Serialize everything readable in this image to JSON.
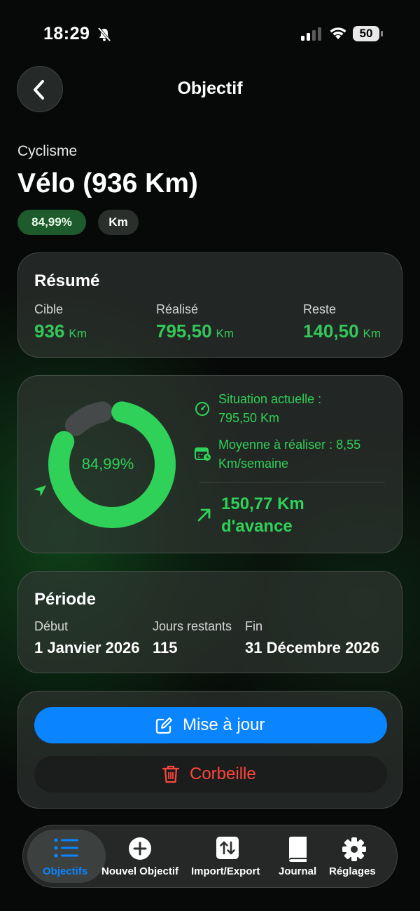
{
  "status": {
    "time": "18:29",
    "battery": "50"
  },
  "nav": {
    "title": "Objectif"
  },
  "goal": {
    "category": "Cyclisme",
    "title": "Vélo (936 Km)",
    "percent_chip": "84,99%",
    "unit_chip": "Km"
  },
  "summary": {
    "title": "Résumé",
    "target_label": "Cible",
    "target_value": "936",
    "target_unit": "Km",
    "done_label": "Réalisé",
    "done_value": "795,50",
    "done_unit": "Km",
    "rest_label": "Reste",
    "rest_value": "140,50",
    "rest_unit": "Km"
  },
  "progress": {
    "percent_text": "84,99%",
    "percent_value": 84.99,
    "status_line1": "Situation actuelle :",
    "status_line2": "795,50 Km",
    "avg_line1": "Moyenne à réaliser : 8,55",
    "avg_line2": "Km/semaine",
    "ahead_line1": "150,77 Km",
    "ahead_line2": "d'avance",
    "accent": "#30d158"
  },
  "period": {
    "title": "Période",
    "start_label": "Début",
    "start_value": "1 Janvier 2026",
    "remaining_label": "Jours restants",
    "remaining_value": "115",
    "end_label": "Fin",
    "end_value": "31 Décembre 2026"
  },
  "actions": {
    "update_label": "Mise à jour",
    "trash_label": "Corbeille",
    "update_color": "#0a84ff",
    "trash_color": "#ff453a"
  },
  "tabs": [
    {
      "label": "Objectifs",
      "icon": "list-icon",
      "selected": true
    },
    {
      "label": "Nouvel Objectif",
      "icon": "plus-circle-icon",
      "selected": false
    },
    {
      "label": "Import/Export",
      "icon": "arrows-updown-icon",
      "selected": false
    },
    {
      "label": "Journal",
      "icon": "book-icon",
      "selected": false
    },
    {
      "label": "Réglages",
      "icon": "gear-icon",
      "selected": false
    }
  ]
}
